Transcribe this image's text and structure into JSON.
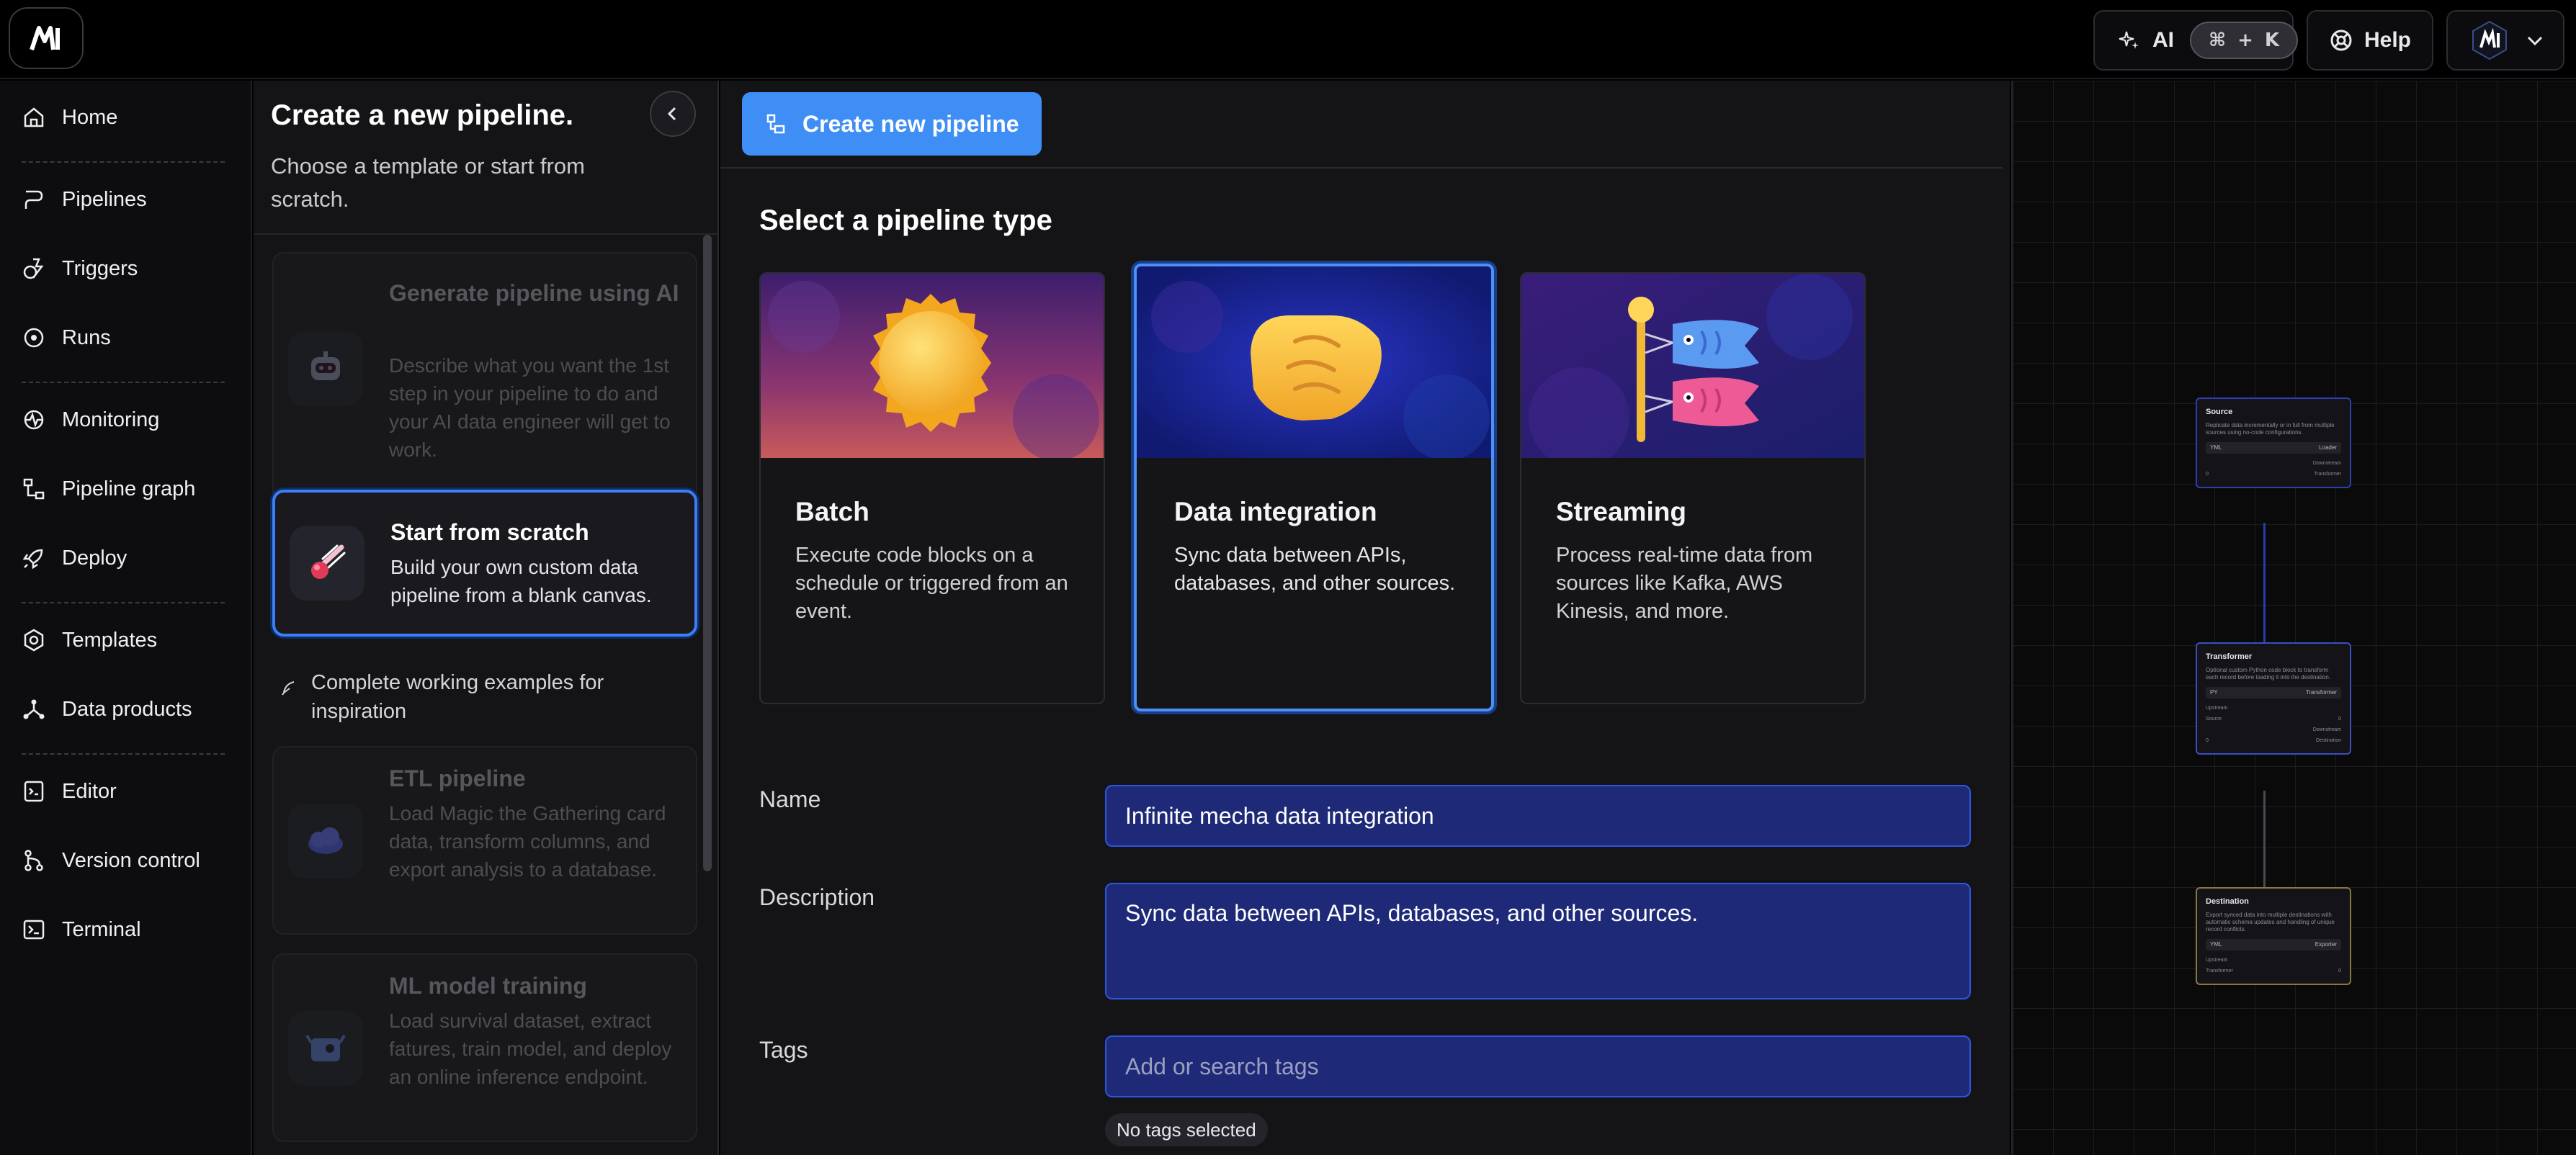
{
  "colors": {
    "accent": "#3f8ef6",
    "selected_border": "#4d8ff8",
    "input_bg": "#1e2a78",
    "source_node_border": "#2c3fb0",
    "transformer_node_border": "#3a4ec0",
    "destination_node_border": "#8a7740"
  },
  "header": {
    "logo_icon": "mage-logo-icon",
    "ai_label": "AI",
    "ai_shortcut_cmd": "⌘",
    "ai_shortcut_plus": "+",
    "ai_shortcut_key": "K",
    "help_label": "Help",
    "avatar_icon": "avatar-hexagon-icon",
    "avatar_menu_icon": "chevron-down-icon"
  },
  "nav": {
    "items": [
      {
        "label": "Home",
        "icon": "home-icon"
      },
      {
        "label": "Pipelines",
        "icon": "pipeline-icon"
      },
      {
        "label": "Triggers",
        "icon": "trigger-icon"
      },
      {
        "label": "Runs",
        "icon": "runs-icon"
      },
      {
        "label": "Monitoring",
        "icon": "monitoring-icon"
      },
      {
        "label": "Pipeline graph",
        "icon": "graph-icon"
      },
      {
        "label": "Deploy",
        "icon": "rocket-icon"
      },
      {
        "label": "Templates",
        "icon": "templates-icon"
      },
      {
        "label": "Data products",
        "icon": "data-products-icon"
      },
      {
        "label": "Editor",
        "icon": "editor-icon"
      },
      {
        "label": "Version control",
        "icon": "version-control-icon"
      },
      {
        "label": "Terminal",
        "icon": "terminal-icon"
      }
    ]
  },
  "panel": {
    "title": "Create a new pipeline.",
    "subtitle": "Choose a template or start from scratch.",
    "templates": [
      {
        "title": "Generate pipeline using AI",
        "description": "Describe what you want the 1st step in your pipeline to do and your AI data engineer will get to work.",
        "icon": "robot-icon"
      },
      {
        "title": "Start from scratch",
        "description": "Build your own custom data pipeline from a blank canvas.",
        "icon": "comet-icon"
      }
    ],
    "examples_heading": "Complete working examples for inspiration",
    "examples": [
      {
        "title": "ETL pipeline",
        "description": "Load Magic the Gathering card data, transform columns, and export analysis to a database.",
        "icon": "cloud-icon"
      },
      {
        "title": "ML model training",
        "description": "Load survival dataset, extract fatures, train model, and deploy an online inference endpoint.",
        "icon": "ml-icon"
      }
    ]
  },
  "main": {
    "create_button": "Create new pipeline",
    "select_title": "Select a pipeline type",
    "types": [
      {
        "name": "Batch",
        "description": "Execute code blocks on a schedule or triggered from an event.",
        "icon": "sun-icon"
      },
      {
        "name": "Data integration",
        "description": "Sync data between APIs, databases, and other sources.",
        "icon": "handshake-icon"
      },
      {
        "name": "Streaming",
        "description": "Process real-time data from sources like Kafka, AWS Kinesis, and more.",
        "icon": "koinobori-icon"
      }
    ],
    "form": {
      "name_label": "Name",
      "name_value": "Infinite mecha data integration",
      "description_label": "Description",
      "description_value": "Sync data between APIs, databases, and other sources.",
      "tags_label": "Tags",
      "tags_placeholder": "Add or search tags",
      "tags_status": "No tags selected"
    }
  },
  "graph": {
    "nodes": [
      {
        "title": "Source",
        "description": "Replicate data incrementally or in full from multiple sources using no-code configurations.",
        "row_left": "YML",
        "row_right": "Loader",
        "line1_left": "",
        "line1_right": "Downstream",
        "line2_left": "0",
        "line2_right": "Transformer"
      },
      {
        "title": "Transformer",
        "description": "Optional custom Python code block to transform each record before loading it into the destination.",
        "row_left": "PY",
        "row_right": "Transformer",
        "line1_left": "Upstream",
        "line1_right": "",
        "line2_left": "Source",
        "line2_right": "0",
        "line3_left": "",
        "line3_right": "Downstream",
        "line4_left": "0",
        "line4_right": "Destination"
      },
      {
        "title": "Destination",
        "description": "Export synced data into multiple destinations with automatic schema updates and handling of unique record conflicts.",
        "row_left": "YML",
        "row_right": "Exporter",
        "line1_left": "Upstream",
        "line1_right": "",
        "line2_left": "Transformer",
        "line2_right": "0"
      }
    ]
  }
}
